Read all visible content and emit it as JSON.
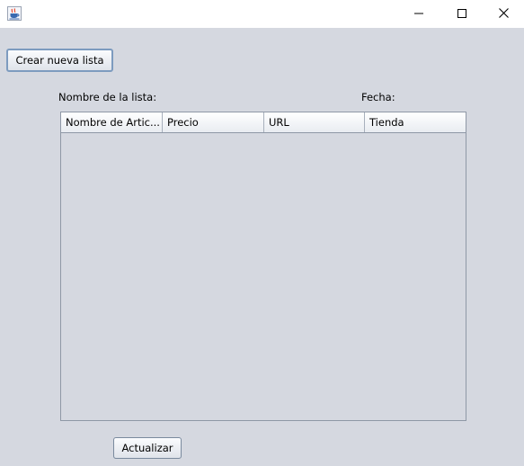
{
  "window": {
    "app_icon": "java-cup-icon",
    "controls": [
      "minimize-icon",
      "maximize-icon",
      "close-icon"
    ]
  },
  "toolbar": {
    "crear_label": "Crear nueva lista"
  },
  "form": {
    "nombre_label": "Nombre de la lista:",
    "fecha_label": "Fecha:"
  },
  "table": {
    "columns": [
      "Nombre de Artic...",
      "Precio",
      "URL",
      "Tienda"
    ],
    "rows": []
  },
  "footer": {
    "actualizar_label": "Actualizar"
  },
  "colors": {
    "background": "#d5d8e0",
    "titlebar": "#ffffff",
    "focus_border": "#7d9bbf"
  }
}
